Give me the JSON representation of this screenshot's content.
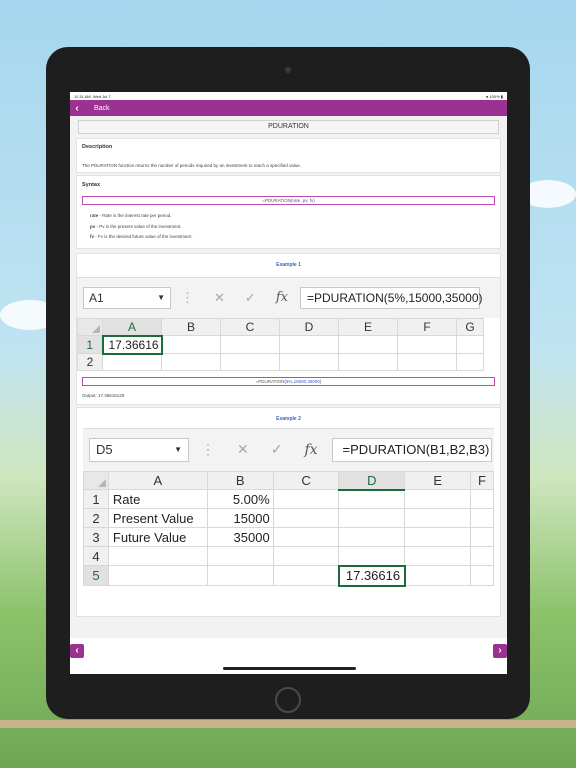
{
  "status": {
    "time": "11:31 AM",
    "date": "Wed Jul 7",
    "battery": "100%"
  },
  "nav": {
    "back_label": "Back"
  },
  "title": "PDURATION",
  "description": {
    "heading": "Description",
    "text": "The PDURATION function returns the number of periods required by an investment to reach a specified value."
  },
  "syntax": {
    "heading": "Syntax",
    "formula_prefix": "=PDURATION(",
    "formula_args": "rate, pv, fv",
    "formula_suffix": ")",
    "args": [
      {
        "name": "rate",
        "desc": " - Rate is the interest rate per period."
      },
      {
        "name": "pv",
        "desc": " - Pv is the present value of the investment."
      },
      {
        "name": "fv",
        "desc": " - Fv is the desired future value of the investment."
      }
    ]
  },
  "example1": {
    "title": "Example 1",
    "namebox": "A1",
    "formula": "=PDURATION(5%,15000,35000)",
    "columns": [
      "A",
      "B",
      "C",
      "D",
      "E",
      "F",
      "G"
    ],
    "rows": [
      "1",
      "2"
    ],
    "a1_value": "17.36616",
    "formula_prefix": "=PDURATION(",
    "formula_args": "5%,15000,35000",
    "formula_suffix": ")",
    "output": "Output: 17.36616129"
  },
  "example2": {
    "title": "Example 2",
    "namebox": "D5",
    "formula": "=PDURATION(B1,B2,B3)",
    "columns": [
      "A",
      "B",
      "C",
      "D",
      "E",
      "F"
    ],
    "rows": [
      {
        "num": "1",
        "a": "Rate",
        "b": "5.00%"
      },
      {
        "num": "2",
        "a": "Present Value",
        "b": "15000"
      },
      {
        "num": "3",
        "a": "Future Value",
        "b": "35000"
      },
      {
        "num": "4",
        "a": "",
        "b": ""
      },
      {
        "num": "5",
        "a": "",
        "b": "",
        "d": "17.36616"
      }
    ]
  },
  "colors": {
    "accent": "#9b3191",
    "excel_green": "#1d6b3b",
    "link_blue": "#3b66b8"
  }
}
